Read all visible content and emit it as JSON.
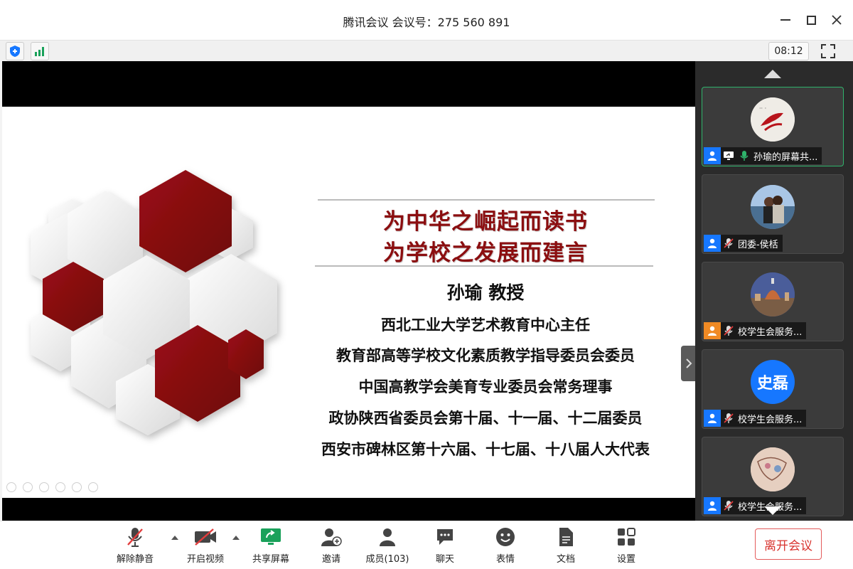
{
  "window": {
    "title": "腾讯会议 会议号：275 560 891"
  },
  "statusbar": {
    "time": "08:12"
  },
  "slide": {
    "title_line1": "为中华之崛起而读书",
    "title_line2": "为学校之发展而建言",
    "speaker": "孙瑜  教授",
    "roles": [
      "西北工业大学艺术教育中心主任",
      "教育部高等学校文化素质教学指导委员会委员",
      "中国高教学会美育专业委员会常务理事",
      "政协陕西省委员会第十届、十一届、十二届委员",
      "西安市碑林区第十六届、十七届、十八届人大代表"
    ]
  },
  "participants": [
    {
      "name": "孙瑜的屏幕共...",
      "avatar": "painting-fish",
      "active": true,
      "mic": "on",
      "sharing": true
    },
    {
      "name": "团委-侯栝",
      "avatar": "photo-couple",
      "active": false,
      "mic": "muted"
    },
    {
      "name": "校学生会服务...",
      "avatar": "photo-cathedral",
      "active": false,
      "mic": "muted"
    },
    {
      "name": "校学生会服务...",
      "avatar_text": "史磊",
      "avatar_color": "#1677ff",
      "active": false,
      "mic": "muted"
    },
    {
      "name": "校学生会服务...",
      "avatar": "painting-sketch",
      "active": false,
      "mic": "muted"
    }
  ],
  "toolbar": {
    "unmute": "解除静音",
    "video": "开启视频",
    "share": "共享屏幕",
    "invite": "邀请",
    "members": "成员(103)",
    "chat": "聊天",
    "emoji": "表情",
    "docs": "文档",
    "settings": "设置",
    "leave": "离开会议"
  },
  "colors": {
    "accent_red": "#8b0e10",
    "leave_red": "#d8342f",
    "active_green": "#2fb36b",
    "share_green": "#1aa15a"
  }
}
